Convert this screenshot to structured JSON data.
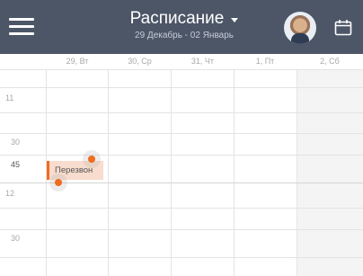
{
  "header": {
    "title": "Расписание",
    "subtitle": "29 Декабрь - 02 Январь",
    "menu_icon": "hamburger-menu-icon",
    "calendar_icon": "calendar-icon",
    "background_color": "#4c5667"
  },
  "days": [
    "29, Вт",
    "30, Ср",
    "31, Чт",
    "1, Пт",
    "2, Сб"
  ],
  "time_labels": {
    "hour_11": "11",
    "min_30_a": "30",
    "min_45": "45",
    "hour_12": "12",
    "min_30_b": "30"
  },
  "event": {
    "title": "Перезвон",
    "accent_color": "#f06c1f",
    "background_color": "#f8dccd"
  }
}
